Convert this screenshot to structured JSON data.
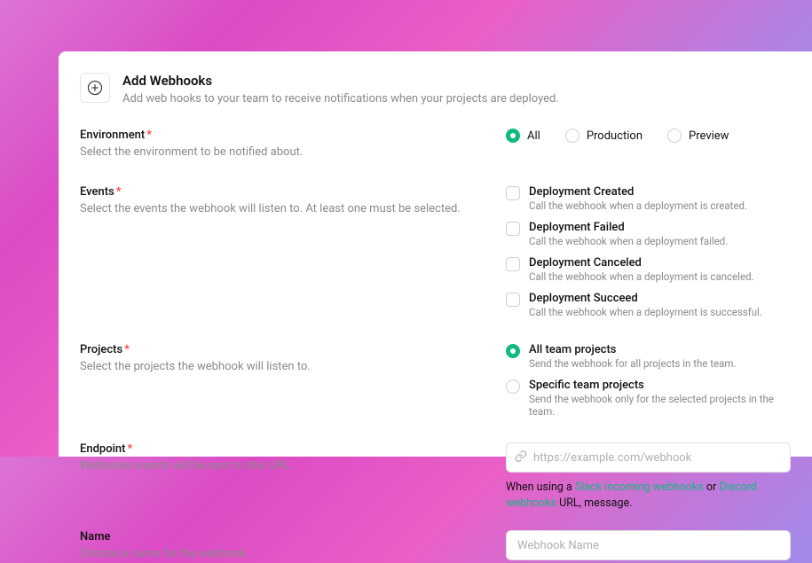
{
  "header": {
    "title": "Add Webhooks",
    "subtitle": "Add web hooks to your team to receive notifications when your projects are deployed."
  },
  "environment": {
    "label": "Environment",
    "help": "Select the environment to be notified about.",
    "options": {
      "all": "All",
      "production": "Production",
      "preview": "Preview"
    },
    "selected": "all"
  },
  "events": {
    "label": "Events",
    "help": "Select the events the webhook will listen to. At least one must be selected.",
    "items": [
      {
        "title": "Deployment Created",
        "sub": "Call the webhook when a deployment is created."
      },
      {
        "title": "Deployment Failed",
        "sub": "Call the webhook when a deployment failed."
      },
      {
        "title": "Deployment Canceled",
        "sub": "Call the webhook when a deployment is canceled."
      },
      {
        "title": "Deployment Succeed",
        "sub": "Call the webhook when a deployment is successful."
      }
    ]
  },
  "projects": {
    "label": "Projects",
    "help": "Select the projects the webhook will listen to.",
    "options": [
      {
        "title": "All team projects",
        "sub": "Send the webhook for all projects in the team."
      },
      {
        "title": "Specific team projects",
        "sub": "Send the webhook only for the selected projects in the team."
      }
    ],
    "selected": 0
  },
  "endpoint": {
    "label": "Endpoint",
    "help": "Webhooks events will be sent to this URL.",
    "placeholder": "https://example.com/webhook",
    "hint_prefix": "When using a ",
    "hint_link1": "Slack incoming webhooks",
    "hint_or": " or ",
    "hint_link2": "Discord webhooks",
    "hint_suffix": " URL, message."
  },
  "name": {
    "label": "Name",
    "help": "Choose a name for the webhook.",
    "placeholder": "Webhook Name"
  }
}
